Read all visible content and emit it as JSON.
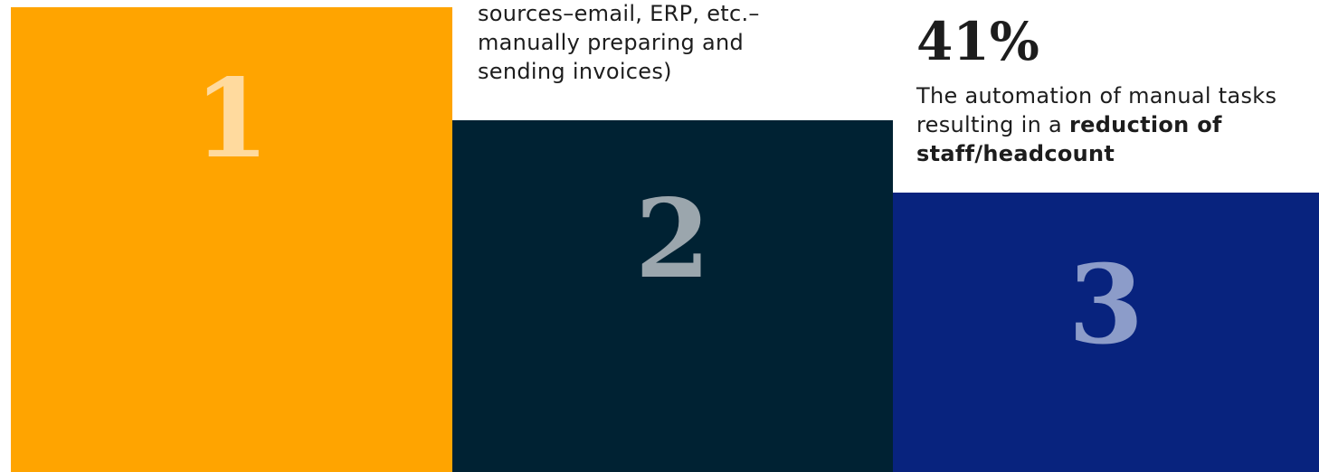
{
  "column1": {
    "number": "1"
  },
  "column2": {
    "number": "2",
    "text_lines": [
      "sources–email, ERP, etc.–",
      "manually preparing and",
      "sending invoices)"
    ]
  },
  "column3": {
    "number": "3",
    "stat": "41%",
    "description_plain": "The automation of manual tasks resulting in a ",
    "description_bold": "reduction of staff/headcount"
  },
  "colors": {
    "block1": "#FFA400",
    "block2": "#002233",
    "block3": "#08237E",
    "numeral1": "#FFDA9E",
    "numeral2": "#9BA6AD",
    "numeral3": "#8C9CC9",
    "text": "#1D1D1D"
  }
}
